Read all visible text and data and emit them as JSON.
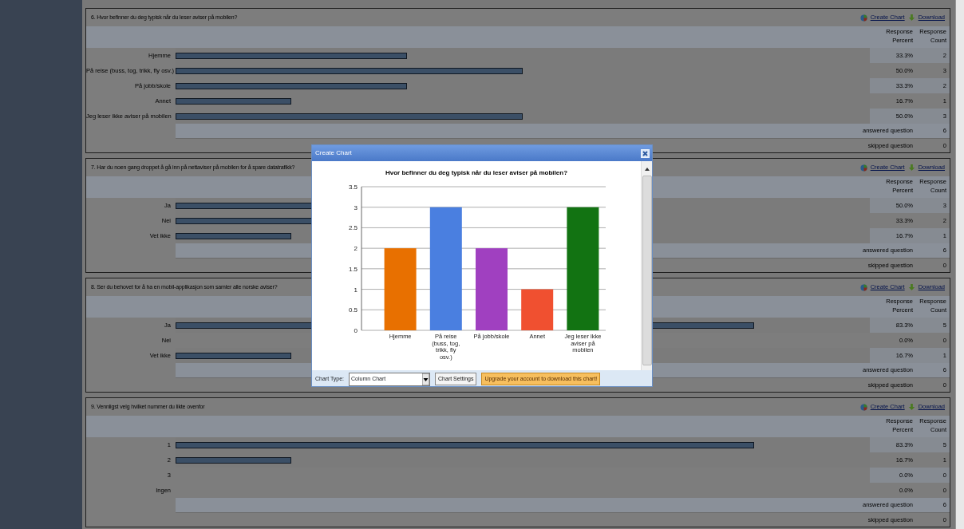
{
  "questions": [
    {
      "title": "6. Hvor befinner du deg typisk når du leser aviser på mobilen?",
      "links": [
        "Create Chart",
        "Download"
      ],
      "columns": [
        "Response Percent",
        "Response Count"
      ],
      "answers": [
        {
          "label": "Hjemme",
          "level": 0.333,
          "percent": "33.3%",
          "count": "2"
        },
        {
          "label": "På reise (buss, tog, trikk, fly osv.)",
          "level": 0.5,
          "percent": "50.0%",
          "count": "3"
        },
        {
          "label": "På jobb/skole",
          "level": 0.333,
          "percent": "33.3%",
          "count": "2"
        },
        {
          "label": "Annet",
          "level": 0.167,
          "percent": "16.7%",
          "count": "1"
        },
        {
          "label": "Jeg leser ikke aviser på mobilen",
          "level": 0.5,
          "percent": "50.0%",
          "count": "3"
        }
      ],
      "summary": [
        {
          "kind": "answered",
          "label": "answered question",
          "count": "6"
        },
        {
          "kind": "skipped",
          "label": "skipped question",
          "count": "0"
        }
      ]
    },
    {
      "title": "7. Har du noen gang droppet å gå inn på nettaviser på mobilen for å spare datatrafikk?",
      "links": [
        "Create Chart",
        "Download"
      ],
      "columns": [
        "Response Percent",
        "Response Count"
      ],
      "answers": [
        {
          "label": "Ja",
          "level": 0.5,
          "percent": "50.0%",
          "count": "3"
        },
        {
          "label": "Nei",
          "level": 0.333,
          "percent": "33.3%",
          "count": "2"
        },
        {
          "label": "Vet ikke",
          "level": 0.167,
          "percent": "16.7%",
          "count": "1"
        }
      ],
      "summary": [
        {
          "kind": "answered",
          "label": "answered question",
          "count": "6"
        },
        {
          "kind": "skipped",
          "label": "skipped question",
          "count": "0"
        }
      ]
    },
    {
      "title": "8. Ser du behovet for å ha en mobil-applikasjon som samler alle norske aviser?",
      "links": [
        "Create Chart",
        "Download"
      ],
      "columns": [
        "Response Percent",
        "Response Count"
      ],
      "answers": [
        {
          "label": "Ja",
          "level": 0.833,
          "percent": "83.3%",
          "count": "5"
        },
        {
          "label": "Nei",
          "percent": "0.0%",
          "count": "0"
        },
        {
          "label": "Vet ikke",
          "level": 0.167,
          "percent": "16.7%",
          "count": "1"
        }
      ],
      "summary": [
        {
          "kind": "answered",
          "label": "answered question",
          "count": "6"
        },
        {
          "kind": "skipped",
          "label": "skipped question",
          "count": "0"
        }
      ]
    },
    {
      "title": "9. Vennligst velg hvilket nummer du likte ovenfor",
      "links": [
        "Create Chart",
        "Download"
      ],
      "columns": [
        "Response Percent",
        "Response Count"
      ],
      "answers": [
        {
          "label": "1",
          "level": 0.833,
          "percent": "83.3%",
          "count": "5"
        },
        {
          "label": "2",
          "level": 0.167,
          "percent": "16.7%",
          "count": "1"
        },
        {
          "label": "3",
          "percent": "0.0%",
          "count": "0"
        },
        {
          "label": "Ingen",
          "percent": "0.0%",
          "count": "0"
        }
      ],
      "summary": [
        {
          "kind": "answered",
          "label": "answered question",
          "count": "6"
        },
        {
          "kind": "skipped",
          "label": "skipped question",
          "count": "0"
        }
      ]
    }
  ],
  "modal": {
    "title": "Create Chart",
    "chart_data": {
      "type": "bar",
      "title": "Hvor befinner du deg typisk når du leser aviser på mobilen?",
      "categories": [
        "Hjemme",
        "På reise (buss, tog, trikk, fly osv.)",
        "På jobb/skole",
        "Annet",
        "Jeg leser ikke aviser på mobilen"
      ],
      "series": [
        {
          "color": "#e87000",
          "values": [
            2,
            null,
            null,
            null,
            null
          ]
        },
        {
          "color": "#4a7fe0",
          "values": [
            null,
            3,
            null,
            null,
            null
          ]
        },
        {
          "color": "#a040c0",
          "values": [
            null,
            null,
            2,
            null,
            null
          ]
        },
        {
          "color": "#f05030",
          "values": [
            null,
            null,
            null,
            1,
            null
          ]
        },
        {
          "color": "#127312",
          "values": [
            null,
            null,
            null,
            null,
            3
          ]
        }
      ],
      "grid": true,
      "ylim": [
        0,
        3.5
      ],
      "yticks": [
        0,
        0.5,
        1,
        1.5,
        2,
        2.5,
        3,
        3.5
      ]
    },
    "chart_type_label": "Chart Type:",
    "chart_type": "Column Chart",
    "buttons": [
      {
        "kind": "plain",
        "label": "Chart Settings"
      },
      {
        "kind": "upgrade",
        "label": "Upgrade your account to download this chart!"
      }
    ]
  }
}
